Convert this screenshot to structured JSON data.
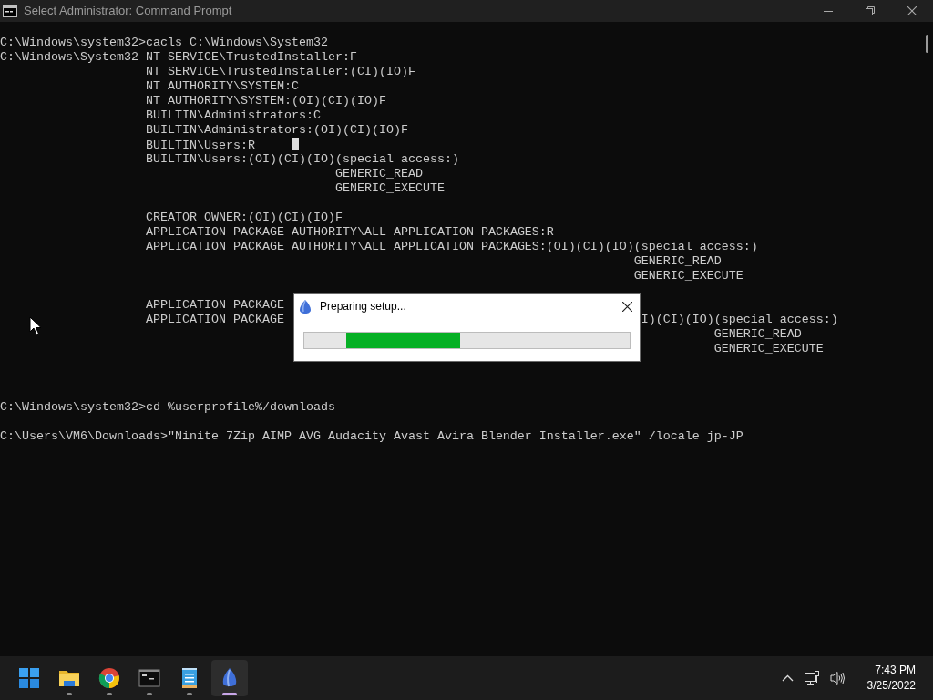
{
  "window": {
    "title": "Select Administrator: Command Prompt"
  },
  "console": {
    "lines": [
      {
        "kind": "text",
        "text": "C:\\Windows\\system32>cacls C:\\Windows\\System32"
      },
      {
        "kind": "text",
        "text": "C:\\Windows\\System32 NT SERVICE\\TrustedInstaller:F"
      },
      {
        "kind": "text",
        "text": "                    NT SERVICE\\TrustedInstaller:(CI)(IO)F"
      },
      {
        "kind": "text",
        "text": "                    NT AUTHORITY\\SYSTEM:C"
      },
      {
        "kind": "text",
        "text": "                    NT AUTHORITY\\SYSTEM:(OI)(CI)(IO)F"
      },
      {
        "kind": "text",
        "text": "                    BUILTIN\\Administrators:C"
      },
      {
        "kind": "text",
        "text": "                    BUILTIN\\Administrators:(OI)(CI)(IO)F"
      },
      {
        "kind": "text",
        "text": "                    BUILTIN\\Users:R",
        "cursor": true
      },
      {
        "kind": "text",
        "text": "                    BUILTIN\\Users:(OI)(CI)(IO)(special access:)"
      },
      {
        "kind": "text",
        "text": "                                              GENERIC_READ"
      },
      {
        "kind": "text",
        "text": "                                              GENERIC_EXECUTE"
      },
      {
        "kind": "blank"
      },
      {
        "kind": "text",
        "text": "                    CREATOR OWNER:(OI)(CI)(IO)F"
      },
      {
        "kind": "text",
        "text": "                    APPLICATION PACKAGE AUTHORITY\\ALL APPLICATION PACKAGES:R"
      },
      {
        "kind": "text",
        "text": "                    APPLICATION PACKAGE AUTHORITY\\ALL APPLICATION PACKAGES:(OI)(CI)(IO)(special access:)"
      },
      {
        "kind": "text",
        "text": "                                                                                       GENERIC_READ"
      },
      {
        "kind": "text",
        "text": "                                                                                       GENERIC_EXECUTE"
      },
      {
        "kind": "blank"
      },
      {
        "kind": "text",
        "text": "                    APPLICATION PACKAGE"
      },
      {
        "kind": "text",
        "text": "                    APPLICATION PACKAGE                                                 I)(CI)(IO)(special access:)"
      },
      {
        "kind": "text",
        "text": "                                                                                                  GENERIC_READ"
      },
      {
        "kind": "text",
        "text": "                                                                                                  GENERIC_EXECUTE"
      },
      {
        "kind": "blank"
      },
      {
        "kind": "blank"
      },
      {
        "kind": "blank"
      },
      {
        "kind": "text",
        "text": "C:\\Windows\\system32>cd %userprofile%/downloads"
      },
      {
        "kind": "blank"
      },
      {
        "kind": "text",
        "text": "C:\\Users\\VM6\\Downloads>\"Ninite 7Zip AIMP AVG Audacity Avast Avira Blender Installer.exe\" /locale jp-JP"
      }
    ]
  },
  "dialog": {
    "title": "Preparing setup...",
    "progress": {
      "kind": "marquee"
    }
  },
  "taskbar": {
    "apps": [
      {
        "kind": "start",
        "running": false,
        "active": false
      },
      {
        "kind": "folder",
        "running": true,
        "active": false
      },
      {
        "kind": "browser",
        "running": true,
        "active": false
      },
      {
        "kind": "terminal",
        "running": true,
        "active": false
      },
      {
        "kind": "notepad",
        "running": true,
        "active": false
      },
      {
        "kind": "installer",
        "running": true,
        "active": true
      }
    ]
  },
  "tray": {
    "time": "7:43 PM",
    "date": "3/25/2022"
  }
}
